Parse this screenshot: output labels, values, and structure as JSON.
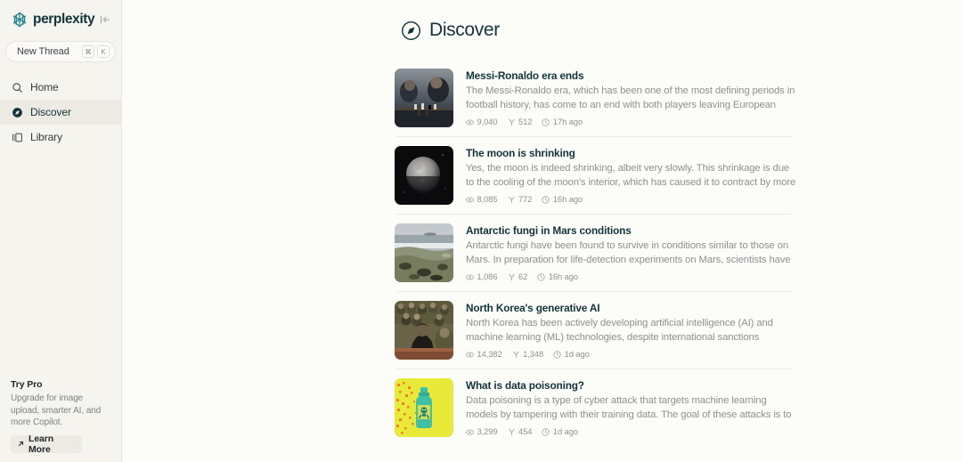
{
  "sidebar": {
    "brand": "perplexity",
    "brand_icon": "perplexity-logo-icon",
    "collapse_icon": "collapse-sidebar-icon",
    "new_thread": {
      "label": "New Thread",
      "shortcut_keys": [
        "⌘",
        "K"
      ]
    },
    "nav": [
      {
        "label": "Home",
        "icon": "search-icon",
        "active": false
      },
      {
        "label": "Discover",
        "icon": "compass-icon",
        "active": true
      },
      {
        "label": "Library",
        "icon": "library-icon",
        "active": false
      }
    ],
    "promo": {
      "title": "Try Pro",
      "description": "Upgrade for image upload, smarter AI, and more Copilot.",
      "button_label": "Learn More",
      "button_icon": "arrow-up-right-icon"
    }
  },
  "header": {
    "title": "Discover",
    "icon": "compass-icon"
  },
  "feed": {
    "meta_icons": {
      "views": "eye-icon",
      "forks": "fork-icon",
      "time": "clock-icon"
    },
    "articles": [
      {
        "title": "Messi-Ronaldo era ends",
        "description": "The Messi-Ronaldo era, which has been one of the most defining periods in football history, has come to an end with both players leaving European football f…",
        "views": "9,040",
        "forks": "512",
        "time": "17h ago",
        "thumbnail": "chess-players-photo",
        "thumb_colors": [
          "#2c3640",
          "#8a8f96",
          "#1a1f26"
        ]
      },
      {
        "title": "The moon is shrinking",
        "description": "Yes, the moon is indeed shrinking, albeit very slowly. This shrinkage is due to the cooling of the moon's interior, which has caused it to contract by more than …",
        "views": "8,085",
        "forks": "772",
        "time": "16h ago",
        "thumbnail": "moon-photo",
        "thumb_colors": [
          "#0c0c0e",
          "#b9b8b6",
          "#3a3a3c"
        ]
      },
      {
        "title": "Antarctic fungi in Mars conditions",
        "description": "Antarctic fungi have been found to survive in conditions similar to those on Mars. In preparation for life-detection experiments on Mars, scientists have condu…",
        "views": "1,086",
        "forks": "62",
        "time": "16h ago",
        "thumbnail": "antarctic-landscape-photo",
        "thumb_colors": [
          "#b4bcc0",
          "#8d9379",
          "#40412f"
        ]
      },
      {
        "title": "North Korea's generative AI",
        "description": "North Korea has been actively developing artificial intelligence (AI) and machine learning (ML) technologies, despite international sanctions imposed over its …",
        "views": "14,382",
        "forks": "1,348",
        "time": "1d ago",
        "thumbnail": "north-korea-officials-photo",
        "thumb_colors": [
          "#55503c",
          "#2a2218",
          "#7d6a4e"
        ]
      },
      {
        "title": "What is data poisoning?",
        "description": "Data poisoning is a type of cyber attack that targets machine learning models by tampering with their training data. The goal of these attacks is to manipulat…",
        "views": "3,299",
        "forks": "454",
        "time": "1d ago",
        "thumbnail": "poison-bottle-illustration",
        "thumb_colors": [
          "#e8e836",
          "#3fbfa8",
          "#f07e2a"
        ]
      }
    ]
  }
}
